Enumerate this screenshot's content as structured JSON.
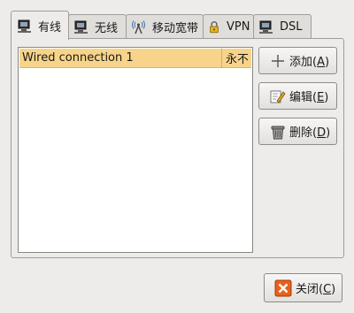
{
  "tabs": [
    {
      "label": "有线",
      "icon": "computer-icon",
      "active": true
    },
    {
      "label": "无线",
      "icon": "computer-icon",
      "active": false
    },
    {
      "label": "移动宽带",
      "icon": "antenna-icon",
      "active": false
    },
    {
      "label": "VPN",
      "icon": "lock-icon",
      "active": false
    },
    {
      "label": "DSL",
      "icon": "computer-icon",
      "active": false
    }
  ],
  "connections": [
    {
      "name": "Wired connection 1",
      "last_used": "永不",
      "selected": true
    }
  ],
  "buttons": {
    "add": {
      "label": "添加(",
      "mnemonic": "A",
      "tail": ")",
      "icon": "plus-icon"
    },
    "edit": {
      "label": "编辑(",
      "mnemonic": "E",
      "tail": ")",
      "icon": "pencil-icon"
    },
    "delete": {
      "label": "删除(",
      "mnemonic": "D",
      "tail": ")",
      "icon": "trash-icon"
    },
    "close": {
      "label": "关闭(",
      "mnemonic": "C",
      "tail": ")",
      "icon": "close-icon"
    }
  },
  "colors": {
    "selection": "#f7d48a",
    "close_icon": "#e8601c"
  }
}
